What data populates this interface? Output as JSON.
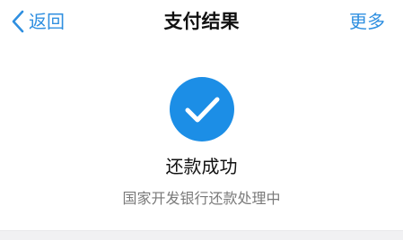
{
  "nav": {
    "back_label": "返回",
    "title": "支付结果",
    "more_label": "更多"
  },
  "result": {
    "icon": "check-circle-icon",
    "title": "还款成功",
    "subtitle": "国家开发银行还款处理中"
  },
  "colors": {
    "accent": "#2f8fe0",
    "success_circle": "#1c8ee6",
    "title_text": "#111111",
    "subtitle_text": "#7a7a7a"
  }
}
